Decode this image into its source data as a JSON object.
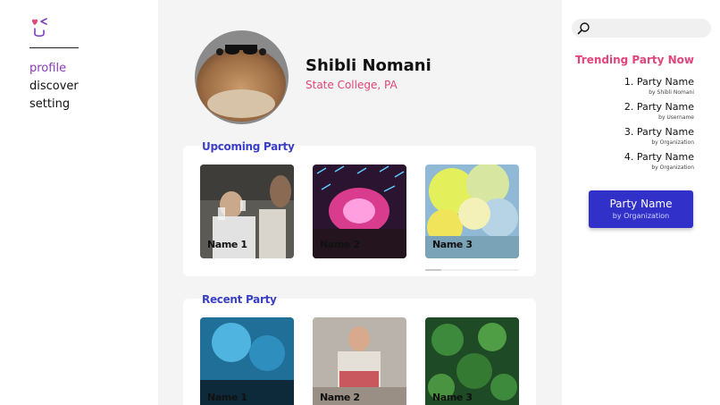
{
  "sidebar": {
    "nav": [
      {
        "label": "profile",
        "active": true
      },
      {
        "label": "discover",
        "active": false
      },
      {
        "label": "setting",
        "active": false
      }
    ],
    "accent": "#8a3bb8"
  },
  "profile": {
    "name": "Shibli Nomani",
    "location": "State College, PA"
  },
  "upcoming": {
    "title": "Upcoming Party",
    "cards": [
      {
        "label": "Name 1",
        "image": "people-toasting-drinks"
      },
      {
        "label": "Name 2",
        "image": "nightclub-lights"
      },
      {
        "label": "Name 3",
        "image": "color-powder-festival"
      }
    ]
  },
  "recent": {
    "title": "Recent Party",
    "cards": [
      {
        "label": "Name 1",
        "image": "concert-crowd-blue"
      },
      {
        "label": "Name 2",
        "image": "man-with-birthday-cake"
      },
      {
        "label": "Name 3",
        "image": "green-clover-leaves"
      }
    ]
  },
  "search": {
    "placeholder": "",
    "icon": "search-icon"
  },
  "trending": {
    "title": "Trending Party Now",
    "items": [
      {
        "name": "1. Party Name",
        "by": "by Shibli Nomani"
      },
      {
        "name": "2. Party Name",
        "by": "by Username"
      },
      {
        "name": "3. Party Name",
        "by": "by Organization"
      },
      {
        "name": "4. Party Name",
        "by": "by Organization"
      }
    ]
  },
  "featured": {
    "name": "Party Name",
    "by": "by Organization",
    "color": "#3131c9"
  },
  "colors": {
    "pink": "#e0457b",
    "blue": "#3a3fc4",
    "background": "#f4f4f4"
  }
}
